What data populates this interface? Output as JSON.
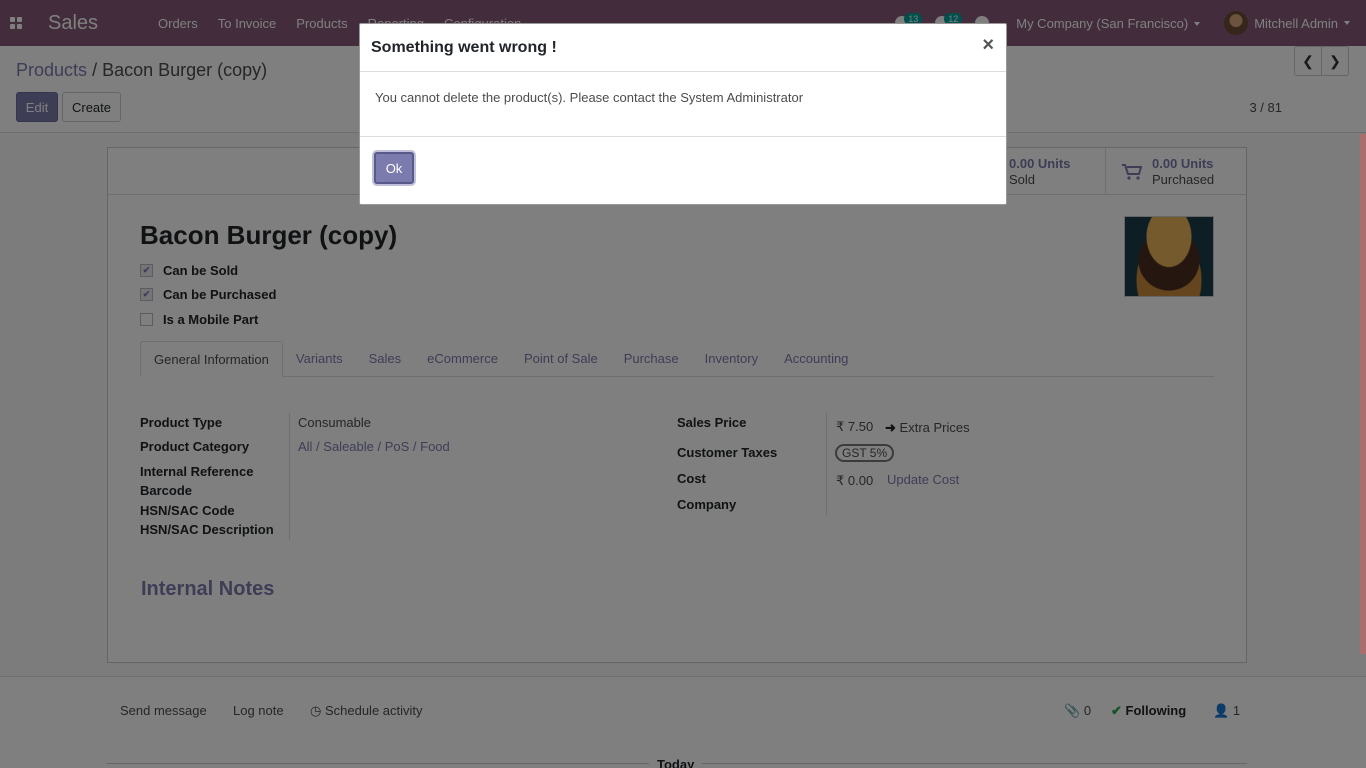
{
  "navbar": {
    "app_name": "Sales",
    "menu": [
      "Orders",
      "To Invoice",
      "Products",
      "Reporting",
      "Configuration"
    ],
    "activity_count": "13",
    "messages_count": "12",
    "company": "My Company (San Francisco)",
    "user": "Mitchell Admin"
  },
  "control": {
    "breadcrumb_parent": "Products",
    "breadcrumb_separator": "/",
    "breadcrumb_current": "Bacon Burger (copy)",
    "edit_label": "Edit",
    "create_label": "Create",
    "pager": "3 / 81"
  },
  "stats": {
    "sold_value": "0.00 Units",
    "sold_label": "Sold",
    "purchased_value": "0.00 Units",
    "purchased_label": "Purchased"
  },
  "product": {
    "name": "Bacon Burger (copy)",
    "can_be_sold": "Can be Sold",
    "can_be_purchased": "Can be Purchased",
    "is_mobile_part": "Is a Mobile Part"
  },
  "tabs": [
    "General Information",
    "Variants",
    "Sales",
    "eCommerce",
    "Point of Sale",
    "Purchase",
    "Inventory",
    "Accounting"
  ],
  "general": {
    "product_type_label": "Product Type",
    "product_type": "Consumable",
    "product_category_label": "Product Category",
    "product_category": "All / Saleable / PoS / Food",
    "internal_reference_label": "Internal Reference",
    "barcode_label": "Barcode",
    "hsn_code_label": "HSN/SAC Code",
    "hsn_desc_label": "HSN/SAC Description",
    "sales_price_label": "Sales Price",
    "sales_price": "₹ 7.50",
    "extra_prices": "Extra Prices",
    "customer_taxes_label": "Customer Taxes",
    "customer_taxes": "GST 5%",
    "cost_label": "Cost",
    "cost": "₹ 0.00",
    "update_cost": "Update Cost",
    "company_label": "Company"
  },
  "internal_notes": "Internal Notes",
  "chatter": {
    "send_message": "Send message",
    "log_note": "Log note",
    "schedule_activity": "Schedule activity",
    "attachments": "0",
    "following": "Following",
    "followers": "1",
    "today": "Today"
  },
  "modal": {
    "title": "Something went wrong !",
    "close": "×",
    "message": "You cannot delete the product(s). Please contact the System Administrator",
    "ok_label": "Ok"
  },
  "colors": {
    "brand": "#875a7b",
    "primary": "#7c7bad"
  }
}
